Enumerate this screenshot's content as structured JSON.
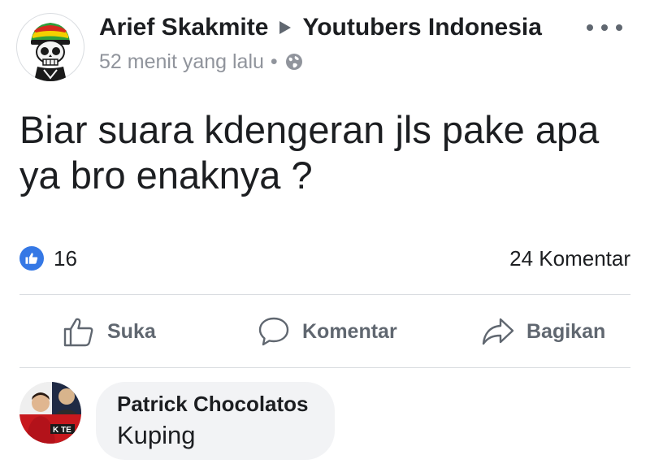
{
  "post": {
    "author": "Arief Skakmite",
    "group": "Youtubers Indonesia",
    "timestamp": "52 menit yang lalu",
    "privacy_icon": "globe-icon",
    "more_icon": "more-options-icon",
    "text": "Biar suara kdengeran jls pake apa ya bro enaknya ?"
  },
  "reactions": {
    "icon": "like-icon",
    "count": "16",
    "comments": "24 Komentar"
  },
  "actions": [
    {
      "label": "Suka",
      "icon": "thumbs-up-icon"
    },
    {
      "label": "Komentar",
      "icon": "comment-icon"
    },
    {
      "label": "Bagikan",
      "icon": "share-icon"
    }
  ],
  "comment": {
    "author": "Patrick Chocolatos",
    "text": "Kuping"
  },
  "colors": {
    "like_blue": "#3578e5",
    "secondary_text": "#90949c",
    "action_text": "#606770",
    "bubble_bg": "#f2f3f5",
    "divider": "#dadde1"
  }
}
